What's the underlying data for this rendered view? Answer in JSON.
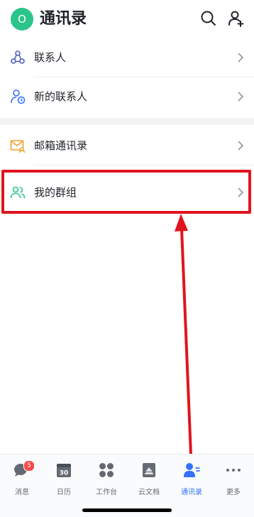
{
  "header": {
    "avatar_text": "O",
    "title": "通讯录",
    "search_icon": "search-icon",
    "add_contact_icon": "add-user-icon"
  },
  "list": {
    "items": [
      {
        "label": "联系人",
        "icon": "contacts-icon"
      },
      {
        "label": "新的联系人",
        "icon": "new-contact-icon"
      },
      {
        "label": "邮箱通讯录",
        "icon": "mail-contacts-icon"
      },
      {
        "label": "我的群组",
        "icon": "group-icon",
        "highlighted": true
      }
    ]
  },
  "tabbar": {
    "tabs": [
      {
        "label": "消息",
        "icon": "chat-icon",
        "badge": "5"
      },
      {
        "label": "日历",
        "icon": "calendar-icon",
        "icon_text": "30"
      },
      {
        "label": "工作台",
        "icon": "workbench-icon"
      },
      {
        "label": "云文档",
        "icon": "cloud-doc-icon"
      },
      {
        "label": "通讯录",
        "icon": "contacts-tab-icon",
        "active": true
      },
      {
        "label": "更多",
        "icon": "more-icon"
      }
    ]
  },
  "colors": {
    "accent": "#3370ff",
    "avatar": "#2bc48a",
    "annotation": "#e0141e",
    "badge": "#f54a45"
  }
}
